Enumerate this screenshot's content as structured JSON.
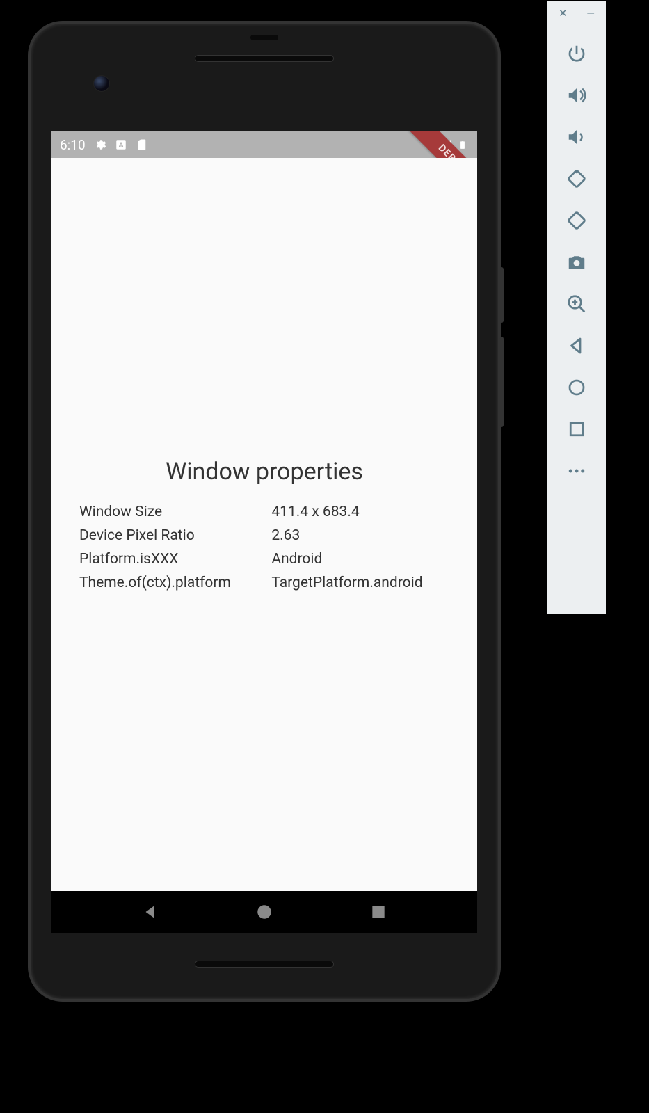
{
  "status_bar": {
    "time": "6:10",
    "icons_left": [
      "settings",
      "a-box",
      "sd-card"
    ],
    "icons_right": [
      "wifi",
      "signal",
      "battery"
    ]
  },
  "debug_banner": "DEBUG",
  "content": {
    "title": "Window properties",
    "rows": [
      {
        "label": "Window Size",
        "value": "411.4 x 683.4"
      },
      {
        "label": "Device Pixel Ratio",
        "value": "2.63"
      },
      {
        "label": "Platform.isXXX",
        "value": "Android"
      },
      {
        "label": "Theme.of(ctx).platform",
        "value": "TargetPlatform.android"
      }
    ]
  },
  "nav_bar": {
    "back": "back",
    "home": "home",
    "overview": "overview"
  },
  "emulator_sidebar": {
    "close": "close",
    "minimize": "minimize",
    "items": [
      "power",
      "volume-up",
      "volume-down",
      "rotate-left",
      "rotate-right",
      "camera",
      "zoom",
      "back",
      "home",
      "overview",
      "more"
    ]
  }
}
